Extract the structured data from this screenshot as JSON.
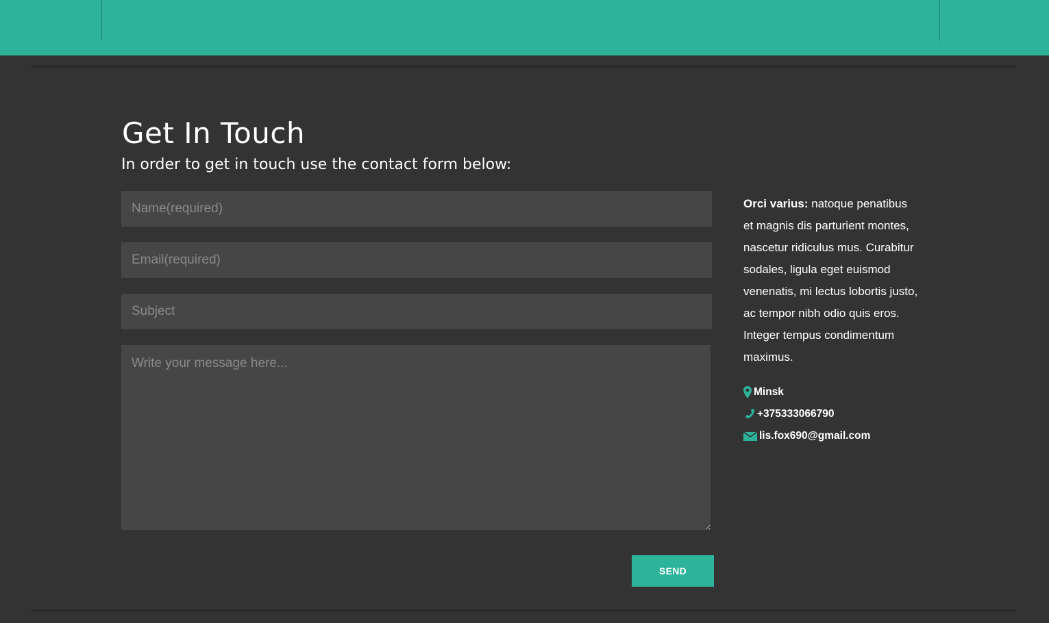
{
  "header": {
    "accent_color": "#2db399"
  },
  "contact_section": {
    "title": "Get In Touch",
    "subtitle": "In order to get in touch use the contact form below:",
    "form": {
      "name_placeholder": "Name(required)",
      "email_placeholder": "Email(required)",
      "subject_placeholder": "Subject",
      "message_placeholder": "Write your message here...",
      "send_label": "SEND"
    },
    "about": {
      "lead": "Orci varius:",
      "text": " natoque penatibus et magnis dis parturient montes, nascetur ridiculus mus. Curabitur sodales, ligula eget euismod venenatis, mi lectus lobortis justo, ac tempor nibh odio quis eros. Integer tempus condimentum maximus."
    },
    "details": {
      "location": "Minsk",
      "phone": "+375333066790",
      "email": "lis.fox690@gmail.com",
      "location_icon": "map-pin-icon",
      "phone_icon": "phone-icon",
      "email_icon": "envelope-icon"
    }
  }
}
